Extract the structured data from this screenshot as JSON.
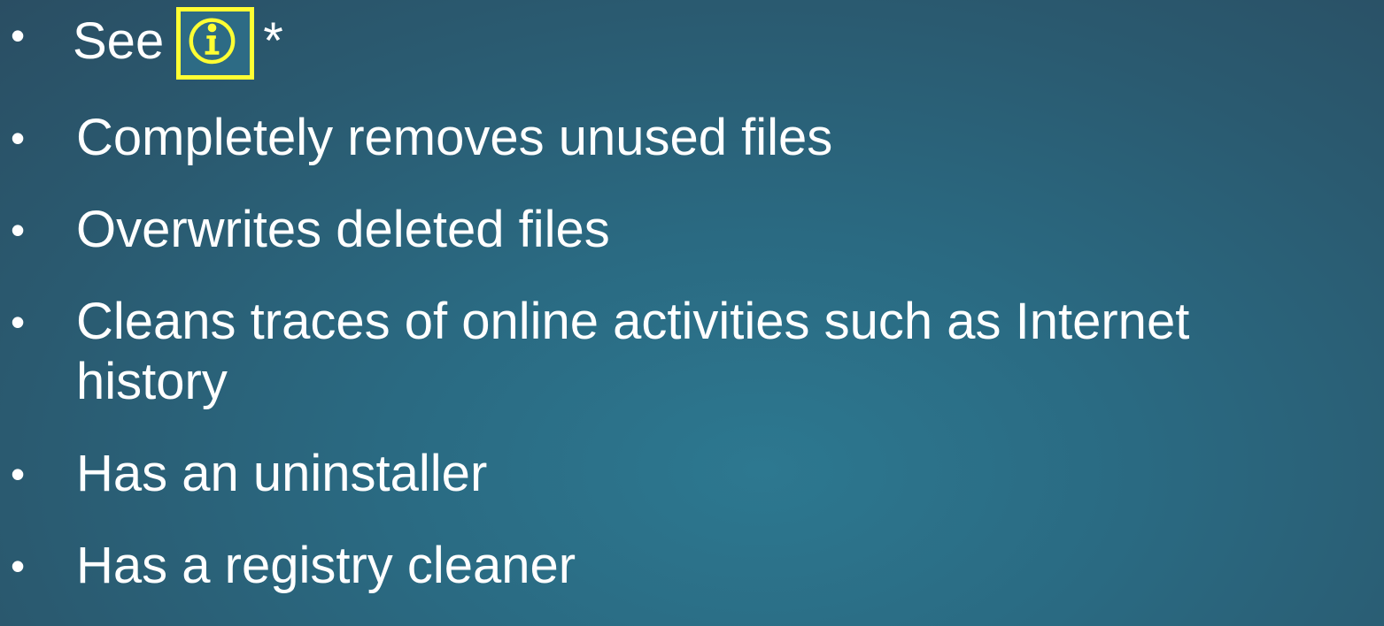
{
  "slide": {
    "items": [
      {
        "prefix": "See",
        "icon": "info-icon",
        "suffix": "*"
      },
      {
        "text": "Completely removes unused files"
      },
      {
        "text": "Overwrites deleted files"
      },
      {
        "text": "Cleans traces of online activities such as Internet"
      },
      {
        "text": "history"
      },
      {
        "text": "Has an uninstaller"
      },
      {
        "text": "Has a registry cleaner"
      }
    ],
    "bullet_char": "•",
    "colors": {
      "text": "#ffffff",
      "highlight": "#ffff33",
      "background": "#2a6a82"
    }
  }
}
